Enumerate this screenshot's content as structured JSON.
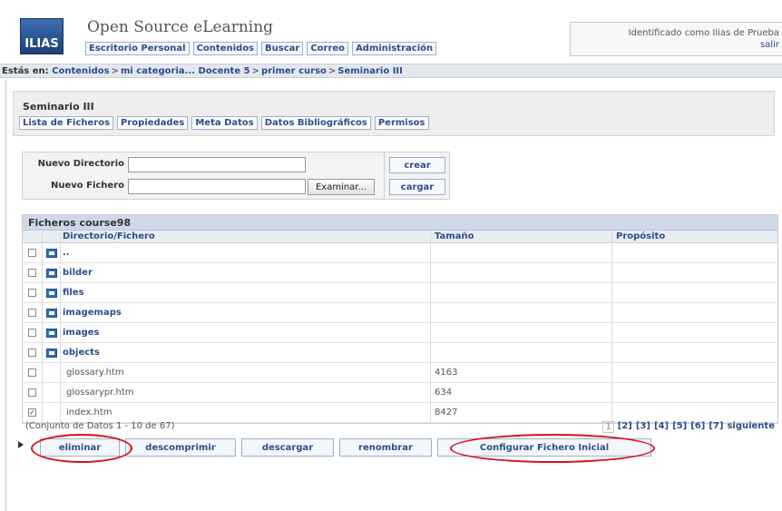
{
  "header": {
    "logo_text": "ILIAS",
    "site_title": "Open Source eLearning",
    "nav": [
      "Escritorio Personal",
      "Contenidos",
      "Buscar",
      "Correo",
      "Administración"
    ],
    "user_status": "Identificado como Ilias de Prueba",
    "logout_label": "salir"
  },
  "locator": {
    "label": "Estás en:",
    "items": [
      "Contenidos",
      "mi categoria...",
      "Docente 5",
      "primer curso",
      "Seminario III"
    ]
  },
  "object": {
    "title": "Seminario III",
    "tabs": [
      "Lista de Ficheros",
      "Propiedades",
      "Meta Datos",
      "Datos Bibliográficos",
      "Permisos"
    ]
  },
  "upload_form": {
    "dir_label": "Nuevo Directorio",
    "dir_value": "",
    "dir_action": "crear",
    "file_label": "Nuevo Fichero",
    "file_value": "",
    "browse_label": "Examinar...",
    "file_action": "cargar"
  },
  "table": {
    "title": "Ficheros course98",
    "columns": [
      "Directorio/Fichero",
      "Tamaño",
      "Propósito"
    ],
    "rows": [
      {
        "name": "..",
        "size": "",
        "purpose": "",
        "type": "dir",
        "checked": false
      },
      {
        "name": "bilder",
        "size": "",
        "purpose": "",
        "type": "dir",
        "checked": false
      },
      {
        "name": "files",
        "size": "",
        "purpose": "",
        "type": "dir",
        "checked": false
      },
      {
        "name": "imagemaps",
        "size": "",
        "purpose": "",
        "type": "dir",
        "checked": false
      },
      {
        "name": "images",
        "size": "",
        "purpose": "",
        "type": "dir",
        "checked": false
      },
      {
        "name": "objects",
        "size": "",
        "purpose": "",
        "type": "dir",
        "checked": false
      },
      {
        "name": "glossary.htm",
        "size": "4163",
        "purpose": "",
        "type": "file",
        "checked": false
      },
      {
        "name": "glossarypr.htm",
        "size": "634",
        "purpose": "",
        "type": "file",
        "checked": false
      },
      {
        "name": "index.htm",
        "size": "8427",
        "purpose": "",
        "type": "file",
        "checked": true
      }
    ],
    "record_count": "(Conjunto de Datos 1 - 10 de 67)",
    "pager": [
      "1",
      "[2]",
      "[3]",
      "[4]",
      "[5]",
      "[6]",
      "[7]",
      "siguiente"
    ]
  },
  "actions": {
    "delete": "eliminar",
    "unzip": "descomprimir",
    "download": "descargar",
    "rename": "renombrar",
    "set_start_file": "Configurar Fichero Inicial"
  },
  "colors": {
    "link": "#2c4d8c",
    "highlight": "#d4121a",
    "header_bar": "#cfd8e6"
  }
}
